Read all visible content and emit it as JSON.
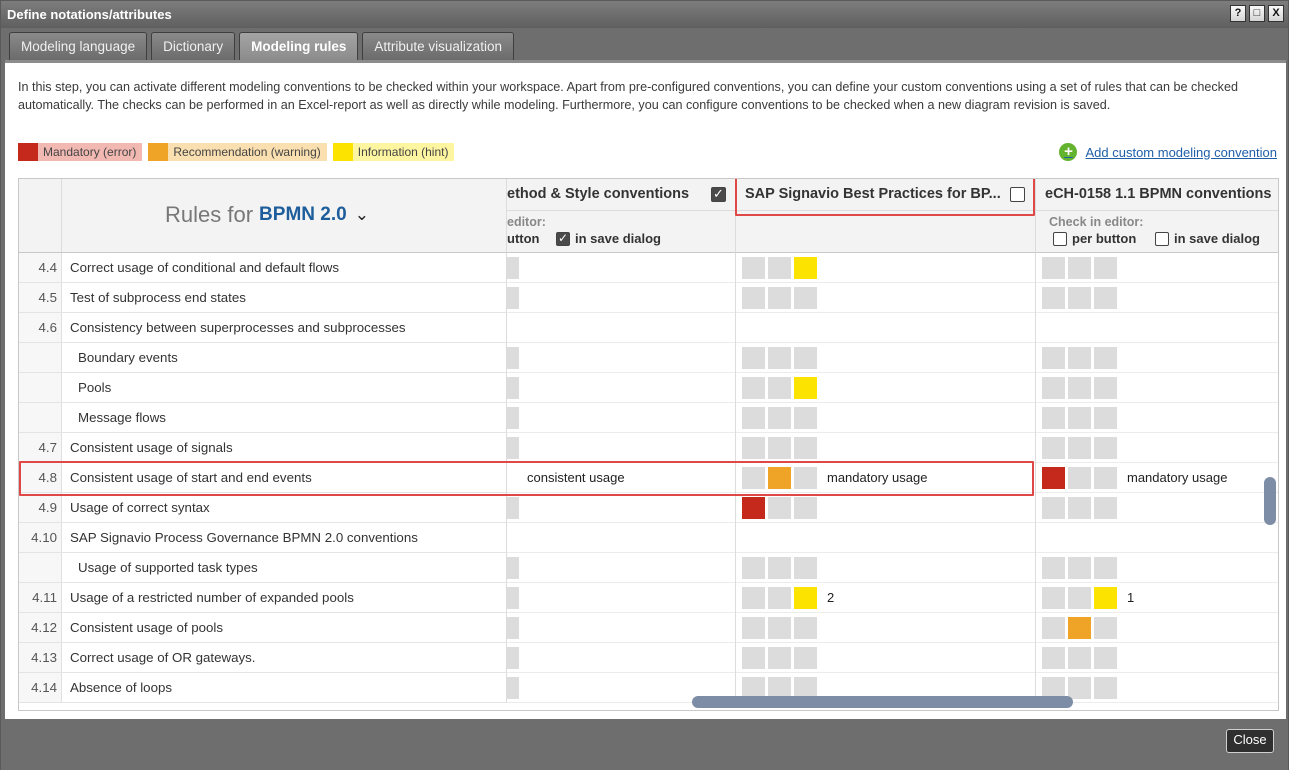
{
  "window": {
    "title": "Define notations/attributes",
    "btn_help": "?",
    "btn_max": "□",
    "btn_close": "X"
  },
  "tabs": [
    "Modeling language",
    "Dictionary",
    "Modeling rules",
    "Attribute visualization"
  ],
  "intro": "In this step, you can activate different modeling conventions to be checked within your workspace. Apart from pre-configured conventions, you can define your custom conventions using a set of rules that can be checked automatically. The checks can be performed in an Excel-report as well as directly while modeling. Furthermore, you can configure conventions to be checked when a new diagram revision is saved.",
  "legend": {
    "mandatory": "Mandatory (error)",
    "recommendation": "Recommendation (warning)",
    "information": "Information (hint)"
  },
  "add_link": "Add custom modeling convention",
  "rules_header": {
    "prefix": "Rules for",
    "language": "BPMN 2.0"
  },
  "columns": {
    "col1": {
      "title": "ethod & Style conventions",
      "check_label": "editor:",
      "opt1": "utton",
      "opt2": "in save dialog"
    },
    "col2": {
      "title": "SAP Signavio Best Practices for BP..."
    },
    "col3": {
      "title": "eCH-0158 1.1 BPMN conventions",
      "check_label": "Check in editor:",
      "opt1": "per button",
      "opt2": "in save dialog"
    }
  },
  "rows": [
    {
      "num": "4.4",
      "label": "Correct usage of conditional and default flows"
    },
    {
      "num": "4.5",
      "label": "Test of subprocess end states"
    },
    {
      "num": "4.6",
      "label": "Consistency between superprocesses and subprocesses"
    },
    {
      "num": "",
      "label": "Boundary events"
    },
    {
      "num": "",
      "label": "Pools"
    },
    {
      "num": "",
      "label": "Message flows"
    },
    {
      "num": "4.7",
      "label": "Consistent usage of signals"
    },
    {
      "num": "4.8",
      "label": "Consistent usage of start and end events"
    },
    {
      "num": "4.9",
      "label": "Usage of correct syntax"
    },
    {
      "num": "4.10",
      "label": "SAP Signavio Process Governance BPMN 2.0 conventions"
    },
    {
      "num": "",
      "label": "Usage of supported task types"
    },
    {
      "num": "4.11",
      "label": "Usage of a restricted number of expanded pools"
    },
    {
      "num": "4.12",
      "label": "Consistent usage of pools"
    },
    {
      "num": "4.13",
      "label": "Correct usage of OR gateways."
    },
    {
      "num": "4.14",
      "label": "Absence of loops"
    }
  ],
  "cell_text": {
    "r8c1": "consistent usage",
    "r8c2": "mandatory usage",
    "r8c3": "mandatory usage",
    "r12c2": "2",
    "r12c3": "1"
  },
  "footer": {
    "close": "Close"
  },
  "colors": {
    "mandatory": "#c4291c",
    "recommendation": "#f0a427",
    "information": "#fde400",
    "link": "#1f5fa8",
    "highlight": "#e04848"
  }
}
